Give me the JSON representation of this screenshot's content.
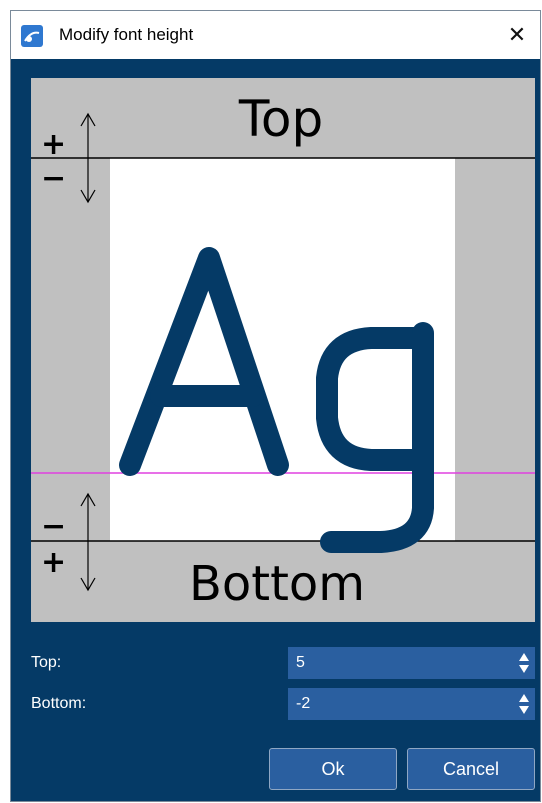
{
  "window": {
    "title": "Modify font height",
    "icon": "app-icon",
    "close_icon": "close-icon",
    "close_glyph": "✕"
  },
  "preview": {
    "top_label": "Top",
    "bottom_label": "Bottom",
    "sample_text": "Ag",
    "top_plus": "+",
    "top_minus": "−",
    "bottom_minus": "−",
    "bottom_plus": "+",
    "baseline_color": "#e040e0",
    "glyph_color": "#053a66"
  },
  "fields": {
    "top_label": "Top:",
    "top_value": "5",
    "bottom_label": "Bottom:",
    "bottom_value": "-2"
  },
  "buttons": {
    "ok_label": "Ok",
    "cancel_label": "Cancel"
  },
  "colors": {
    "dialog_bg": "#053a66",
    "input_bg": "#2a5fa0",
    "preview_gray": "#c0c0c0"
  }
}
